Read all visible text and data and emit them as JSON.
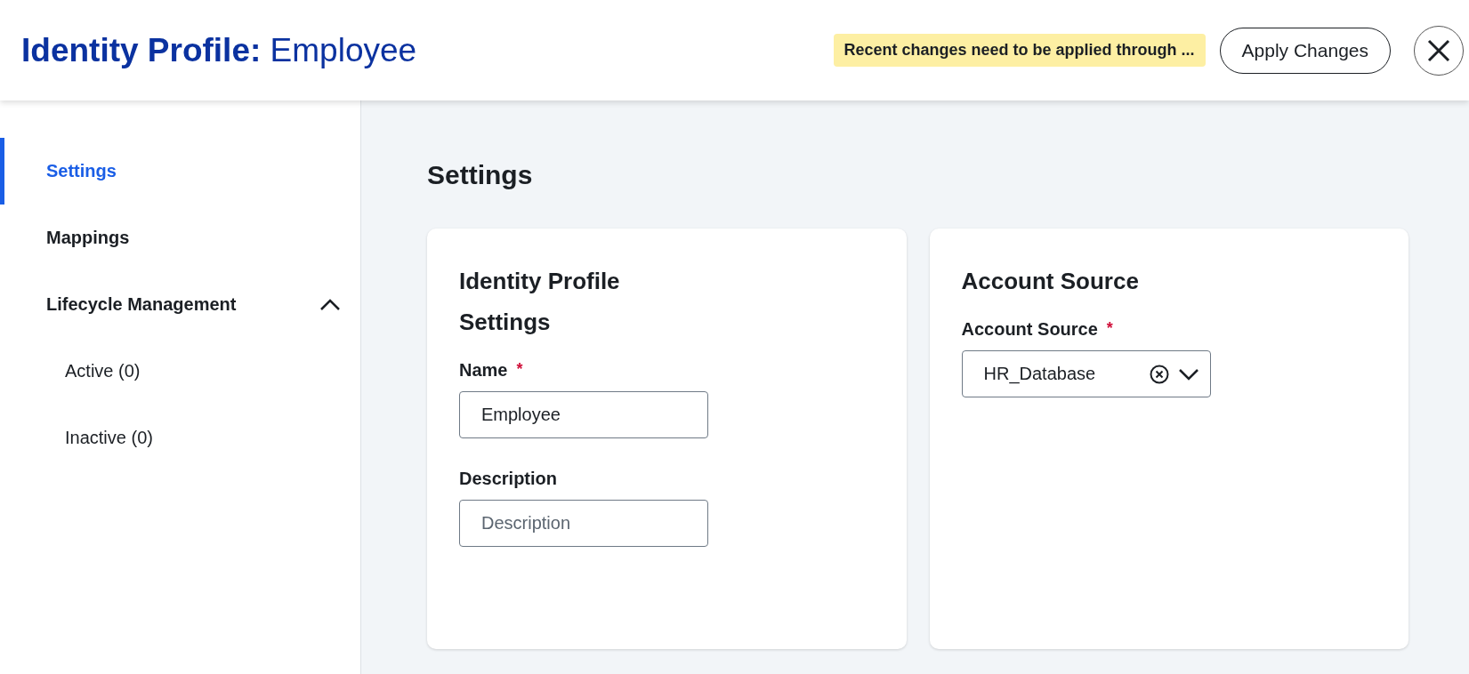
{
  "header": {
    "title": "**Identity Profile:** Employee",
    "notice": "Recent changes need to be applied through ...",
    "apply_button": "Apply Changes"
  },
  "sidebar": {
    "items": [
      {
        "label": "Settings",
        "selected": true
      },
      {
        "label": "Mappings",
        "selected": false
      },
      {
        "label": "Lifecycle Management",
        "selected": false,
        "expanded": true,
        "children": [
          {
            "label": "Active (0)",
            "selected": false
          },
          {
            "label": "Inactive (0)",
            "selected": false
          }
        ]
      }
    ]
  },
  "main": {
    "heading": "Settings",
    "cards": [
      {
        "title": "Identity Profile Settings",
        "fields": [
          {
            "kind": "text",
            "label": "Name",
            "required_mark": "*",
            "value": "Employee"
          },
          {
            "kind": "text",
            "label": "Description",
            "placeholder": "Description"
          }
        ]
      },
      {
        "title": "Account Source",
        "fields": [
          {
            "kind": "select",
            "label": "Account Source",
            "required_mark": "*",
            "value": "HR_Database"
          }
        ]
      }
    ]
  }
}
